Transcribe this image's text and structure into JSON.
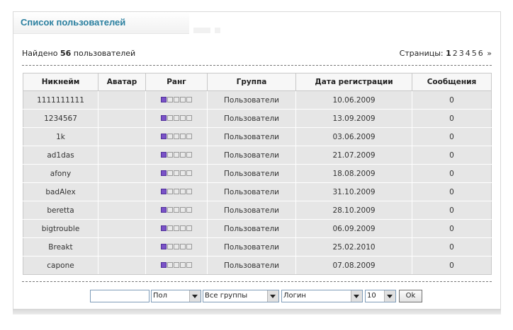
{
  "header": {
    "title": "Список пользователей"
  },
  "summary": {
    "found_prefix": "Найдено",
    "found_count": "56",
    "found_suffix": "пользователей"
  },
  "pagination": {
    "label": "Страницы:",
    "current": "1",
    "pages": [
      "2",
      "3",
      "4",
      "5",
      "6"
    ],
    "next": "»"
  },
  "table": {
    "columns": [
      "Никнейм",
      "Аватар",
      "Ранг",
      "Группа",
      "Дата регистрации",
      "Сообщения"
    ],
    "rows": [
      {
        "nick": "1111111111",
        "group": "Пользователи",
        "date": "10.06.2009",
        "messages": "0"
      },
      {
        "nick": "1234567",
        "group": "Пользователи",
        "date": "13.09.2009",
        "messages": "0"
      },
      {
        "nick": "1k",
        "group": "Пользователи",
        "date": "03.06.2009",
        "messages": "0"
      },
      {
        "nick": "ad1das",
        "group": "Пользователи",
        "date": "21.07.2009",
        "messages": "0"
      },
      {
        "nick": "afony",
        "group": "Пользователи",
        "date": "18.08.2009",
        "messages": "0"
      },
      {
        "nick": "badAlex",
        "group": "Пользователи",
        "date": "31.10.2009",
        "messages": "0"
      },
      {
        "nick": "beretta",
        "group": "Пользователи",
        "date": "28.10.2009",
        "messages": "0"
      },
      {
        "nick": "bigtrouble",
        "group": "Пользователи",
        "date": "06.09.2009",
        "messages": "0"
      },
      {
        "nick": "Breakt",
        "group": "Пользователи",
        "date": "25.02.2010",
        "messages": "0"
      },
      {
        "nick": "capone",
        "group": "Пользователи",
        "date": "07.08.2009",
        "messages": "0"
      }
    ],
    "rank_level": 1,
    "rank_max": 5
  },
  "filters": {
    "search_value": "",
    "gender_selected": "Пол",
    "group_selected": "Все группы",
    "sort_selected": "Логин",
    "per_page_selected": "10",
    "submit_label": "Ok"
  },
  "colors": {
    "title": "#2a7f9f",
    "rank_active": "#7a52c7",
    "row_bg": "#e6e6e6"
  }
}
